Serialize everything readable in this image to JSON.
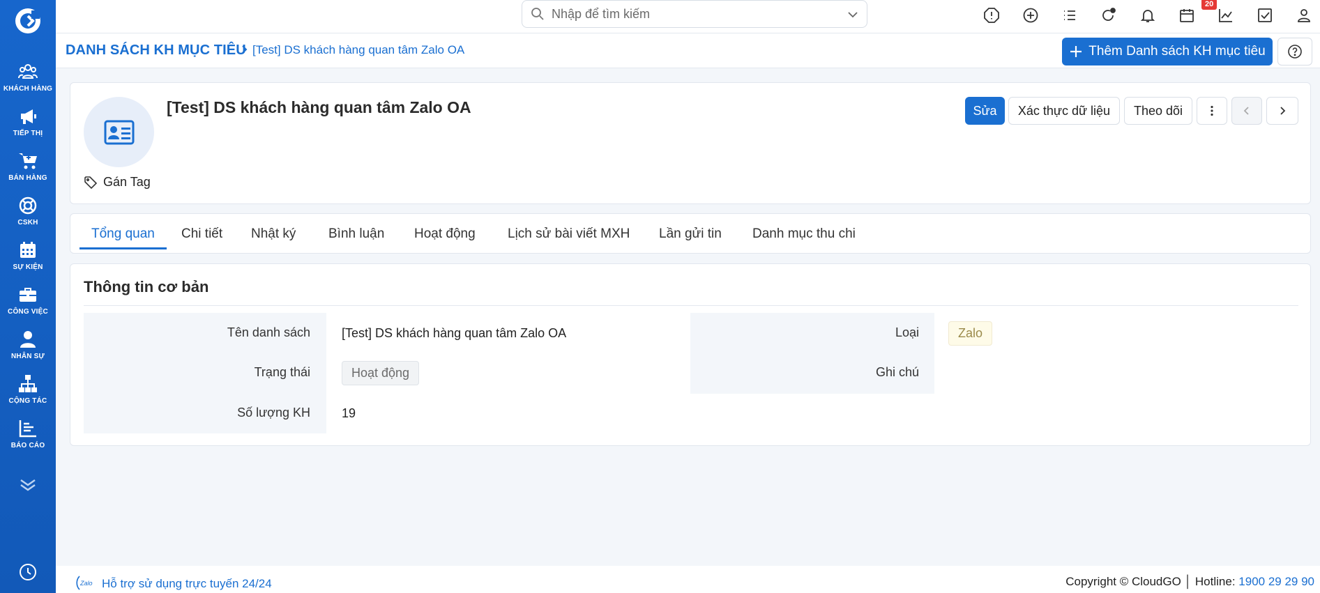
{
  "sidebar": {
    "items": [
      {
        "label": "KHÁCH HÀNG",
        "icon": "users-icon"
      },
      {
        "label": "TIẾP THỊ",
        "icon": "megaphone-icon"
      },
      {
        "label": "BÁN HÀNG",
        "icon": "cart-icon"
      },
      {
        "label": "CSKH",
        "icon": "lifebuoy-icon"
      },
      {
        "label": "SỰ KIỆN",
        "icon": "calendar-icon"
      },
      {
        "label": "CÔNG VIỆC",
        "icon": "briefcase-icon"
      },
      {
        "label": "NHÂN SỰ",
        "icon": "person-icon"
      },
      {
        "label": "CỘNG TÁC",
        "icon": "org-chart-icon"
      },
      {
        "label": "BÁO CÁO",
        "icon": "report-icon"
      }
    ]
  },
  "topbar": {
    "search_placeholder": "Nhập để tìm kiếm",
    "notification_count": "20"
  },
  "breadcrumb": {
    "root": "DANH SÁCH KH MỤC TIÊU",
    "current": "[Test] DS khách hàng quan tâm Zalo OA"
  },
  "actions": {
    "add_label": "Thêm Danh sách KH mục tiêu"
  },
  "record": {
    "title": "[Test] DS khách hàng quan tâm Zalo OA",
    "tag_label": "Gán Tag",
    "edit_label": "Sửa",
    "verify_label": "Xác thực dữ liệu",
    "follow_label": "Theo dõi"
  },
  "tabs": [
    {
      "label": "Tổng quan",
      "active": true
    },
    {
      "label": "Chi tiết"
    },
    {
      "label": "Nhật ký"
    },
    {
      "label": "Bình luận"
    },
    {
      "label": "Hoạt động"
    },
    {
      "label": "Lịch sử bài viết MXH"
    },
    {
      "label": "Lần gửi tin"
    },
    {
      "label": "Danh mục thu chi"
    }
  ],
  "basic_info": {
    "title": "Thông tin cơ bản",
    "list_name_label": "Tên danh sách",
    "list_name_value": "[Test] DS khách hàng quan tâm Zalo OA",
    "status_label": "Trạng thái",
    "status_value": "Hoạt động",
    "count_label": "Số lượng KH",
    "count_value": "19",
    "type_label": "Loại",
    "type_value": "Zalo",
    "note_label": "Ghi chú",
    "note_value": ""
  },
  "footer": {
    "zalo_logo_text": "Zalo",
    "support": "Hỗ trợ sử dụng trực tuyến 24/24",
    "copyright": "Copyright © CloudGO",
    "hotline_label": "Hotline:",
    "hotline_number": "1900 29 29 90"
  },
  "colors": {
    "brand": "#1a6fd1",
    "sidebar": "#1565c0",
    "badge": "#e53935"
  }
}
